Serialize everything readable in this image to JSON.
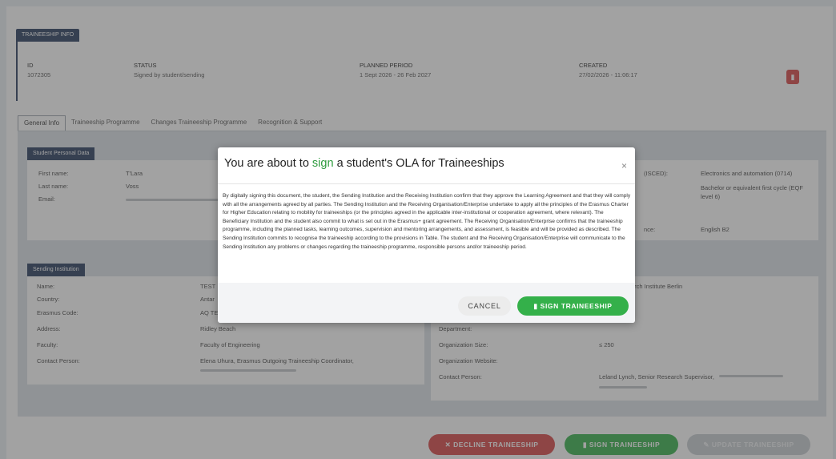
{
  "header": {
    "section_label": "TRAINEESHIP INFO",
    "id_label": "ID",
    "id_value": "1072305",
    "status_label": "STATUS",
    "status_value": "Signed by student/sending",
    "period_label": "PLANNED PERIOD",
    "period_value": "1 Sept 2026 - 26 Feb 2027",
    "created_label": "CREATED",
    "created_value": "27/02/2026 - 11:06:17",
    "pdf_icon": "pdf-file-icon"
  },
  "tabs": [
    {
      "label": "General Info"
    },
    {
      "label": "Traineeship Programme"
    },
    {
      "label": "Changes Traineeship Programme"
    },
    {
      "label": "Recognition & Support"
    }
  ],
  "student": {
    "section_label": "Student Personal Data",
    "first_name_label": "First name:",
    "first_name": "T'Lara",
    "last_name_label": "Last name:",
    "last_name": "Voss",
    "email_label": "Email:",
    "field_label": "(ISCED):",
    "field_value": "Electronics and automation (0714)",
    "level_value_1": "Bachelor or equivalent first cycle (EQF",
    "level_value_2": "level 6)",
    "language_label": "nce:",
    "language_value": "English B2"
  },
  "sending": {
    "section_label": "Sending Institution",
    "name_label": "Name:",
    "name_value": "TEST",
    "country_label": "Country:",
    "country_value": "Antar",
    "erasmus_label": "Erasmus Code:",
    "erasmus_value": "AQ TE",
    "address_label": "Address:",
    "address_value": "Ridley Beach",
    "faculty_label": "Faculty:",
    "faculty_value": "Faculty of Engineering",
    "contact_label": "Contact Person:",
    "contact_value": "Elena Uhura, Erasmus Outgoing Traineeship Coordinator,"
  },
  "receiving": {
    "name_value": "arch Institute Berlin",
    "department_label": "Department:",
    "size_label": "Organization Size:",
    "size_value": "≤ 250",
    "website_label": "Organization Website:",
    "contact_label": "Contact Person:",
    "contact_value": "Leland Lynch, Senior Research Supervisor,"
  },
  "actions": {
    "decline": "DECLINE TRAINEESHIP",
    "sign": "SIGN TRAINEESHIP",
    "update": "UPDATE TRAINEESHIP"
  },
  "modal": {
    "title_prefix": "You are about to",
    "title_highlight": "sign",
    "title_suffix": "a student's OLA for Traineeships",
    "close": "×",
    "body": "By digitally signing this document, the student, the Sending Institution and the Receiving Institution confirm that they approve the Learning Agreement and that they will comply with all the arrangements agreed by all parties. The Sending Institution and the Receiving Organisation/Enterprise undertake to apply all the principles of the Erasmus Charter for Higher Education relating to mobility for traineeships (or the principles agreed in the applicable inter-institutional or cooperation agreement, where relevant). The Beneficiary Institution and the student also commit to what is set out in the Erasmus+ grant agreement. The Receiving Organisation/Enterprise confirms that the traineeship programme, including the planned tasks, learning outcomes, supervision and mentoring arrangements, and assessment, is feasible and will be provided as described. The Sending Institution commits to recognise the traineeship according to the provisions in Table. The student and the Receiving Organisation/Enterprise will communicate to the Sending Institution any problems or changes regarding the traineeship programme, responsible persons and/or traineeship period.",
    "cancel": "CANCEL",
    "sign": "SIGN TRAINEESHIP"
  },
  "colors": {
    "navy": "#263a5c",
    "green": "#34b04a",
    "red": "#d64545"
  }
}
